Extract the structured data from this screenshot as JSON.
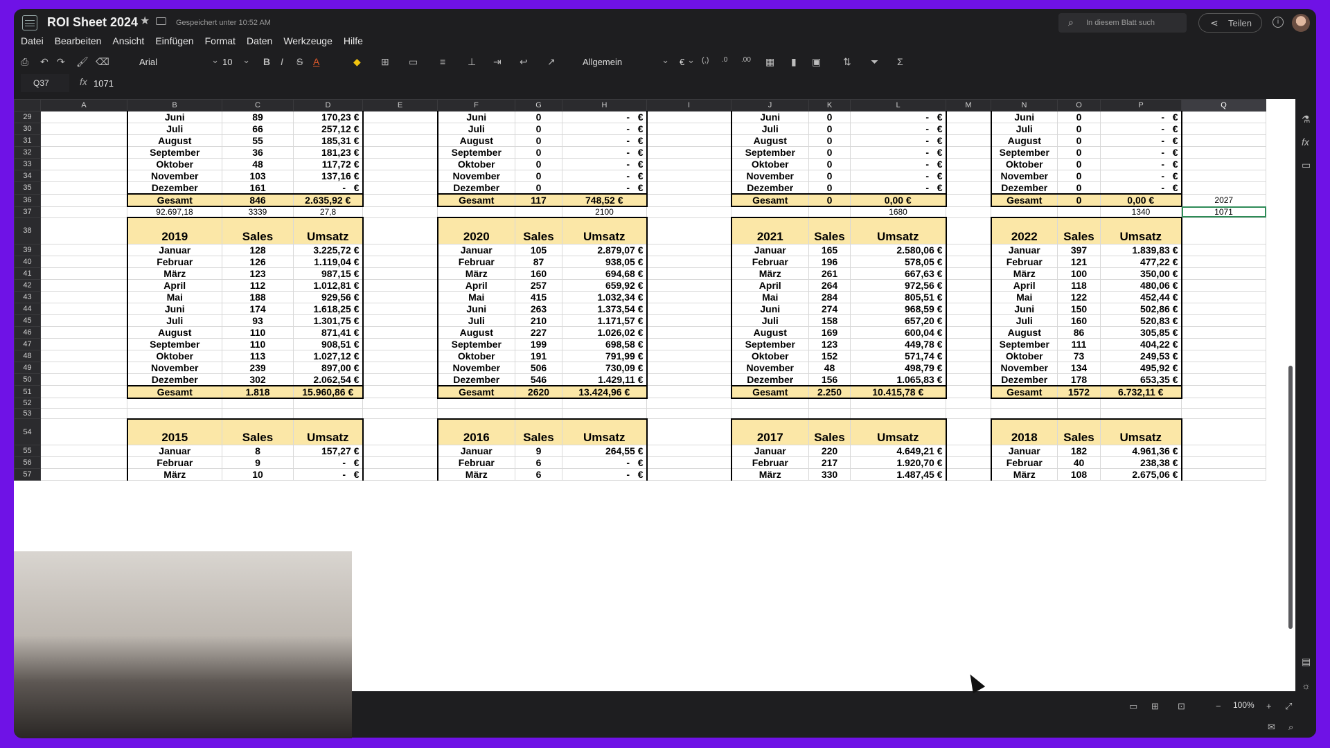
{
  "app": {
    "title": "ROI Sheet 2024",
    "saved_status": "Gespeichert unter 10:52 AM",
    "search_placeholder": "In diesem Blatt such",
    "share_label": "Teilen"
  },
  "menu": [
    "Datei",
    "Bearbeiten",
    "Ansicht",
    "Einfügen",
    "Format",
    "Daten",
    "Werkzeuge",
    "Hilfe"
  ],
  "toolbar": {
    "font": "Arial",
    "font_size": "10",
    "number_format": "Allgemein",
    "currency": "€",
    "icons": [
      "print-icon",
      "undo-icon",
      "redo-icon",
      "paint-format-icon",
      "clear-format-icon",
      "bold-icon",
      "italic-icon",
      "strikethrough-icon",
      "text-color-icon",
      "fill-color-icon",
      "borders-icon",
      "merge-icon",
      "align-horizontal-icon",
      "align-vertical-icon",
      "indent-icon",
      "wrap-icon",
      "rotate-icon",
      "parentheses-icon",
      "decimal-decrease-icon",
      "decimal-increase-icon",
      "insert-table-icon",
      "chart-icon",
      "image-icon",
      "sort-icon",
      "filter-icon",
      "sum-icon"
    ]
  },
  "formula_bar": {
    "cell_ref": "Q37",
    "fx": "fx",
    "value": "1071"
  },
  "columns": [
    "",
    "A",
    "B",
    "C",
    "D",
    "E",
    "F",
    "G",
    "H",
    "I",
    "J",
    "K",
    "L",
    "M",
    "N",
    "O",
    "P",
    "Q"
  ],
  "months": [
    "Januar",
    "Februar",
    "März",
    "April",
    "Mai",
    "Juni",
    "Juli",
    "August",
    "September",
    "Oktober",
    "November",
    "Dezember"
  ],
  "labels": {
    "sales": "Sales",
    "umsatz": "Umsatz",
    "gesamt": "Gesamt",
    "dash": "-",
    "euro": "€"
  },
  "top_rows": {
    "row_numbers": [
      "29",
      "30",
      "31",
      "32",
      "33",
      "34",
      "35"
    ],
    "months": [
      "Juni",
      "Juli",
      "August",
      "September",
      "Oktober",
      "November",
      "Dezember"
    ],
    "b_sales": [
      "89",
      "66",
      "55",
      "36",
      "48",
      "103",
      "161"
    ],
    "b_umsatz": [
      "170,23 €",
      "257,12 €",
      "185,31 €",
      "181,23 €",
      "117,72 €",
      "137,16 €",
      "-"
    ],
    "zero": "0",
    "row36": {
      "num": "36",
      "b_sales": "846",
      "b_umsatz": "2.635,92 €",
      "f_sales": "117",
      "f_umsatz": "748,52 €",
      "j_sales": "0",
      "j_umsatz": "0,00 €",
      "n_sales": "0",
      "n_umsatz": "0,00 €",
      "q": "2027"
    },
    "row37": {
      "num": "37",
      "b": "92.697,18",
      "c": "3339",
      "d": "27,8",
      "h": "2100",
      "l": "1680",
      "p": "1340",
      "q": "1071"
    }
  },
  "block_rows_1": [
    "38",
    "39",
    "40",
    "41",
    "42",
    "43",
    "44",
    "45",
    "46",
    "47",
    "48",
    "49",
    "50",
    "51"
  ],
  "block_rows_2": [
    "54",
    "55",
    "56",
    "57"
  ],
  "gap_rows": [
    "52",
    "53"
  ],
  "tables_row1": [
    {
      "year": "2019",
      "sales": [
        "128",
        "126",
        "123",
        "112",
        "188",
        "174",
        "93",
        "110",
        "110",
        "113",
        "239",
        "302"
      ],
      "umsatz": [
        "3.225,72 €",
        "1.119,04 €",
        "987,15 €",
        "1.012,81 €",
        "929,56 €",
        "1.618,25 €",
        "1.301,75 €",
        "871,41 €",
        "908,51 €",
        "1.027,12 €",
        "897,00 €",
        "2.062,54 €"
      ],
      "total_sales": "1.818",
      "total_umsatz": "15.960,86 €"
    },
    {
      "year": "2020",
      "sales": [
        "105",
        "87",
        "160",
        "257",
        "415",
        "263",
        "210",
        "227",
        "199",
        "191",
        "506",
        "546"
      ],
      "umsatz": [
        "2.879,07 €",
        "938,05 €",
        "694,68 €",
        "659,92 €",
        "1.032,34 €",
        "1.373,54 €",
        "1.171,57 €",
        "1.026,02 €",
        "698,58 €",
        "791,99 €",
        "730,09 €",
        "1.429,11 €"
      ],
      "total_sales": "2620",
      "total_umsatz": "13.424,96 €"
    },
    {
      "year": "2021",
      "sales": [
        "165",
        "196",
        "261",
        "264",
        "284",
        "274",
        "158",
        "169",
        "123",
        "152",
        "48",
        "156"
      ],
      "umsatz": [
        "2.580,06 €",
        "578,05 €",
        "667,63 €",
        "972,56 €",
        "805,51 €",
        "968,59 €",
        "657,20 €",
        "600,04 €",
        "449,78 €",
        "571,74 €",
        "498,79 €",
        "1.065,83 €"
      ],
      "total_sales": "2.250",
      "total_umsatz": "10.415,78 €"
    },
    {
      "year": "2022",
      "sales": [
        "397",
        "121",
        "100",
        "118",
        "122",
        "150",
        "160",
        "86",
        "111",
        "73",
        "134",
        "178"
      ],
      "umsatz": [
        "1.839,83 €",
        "477,22 €",
        "350,00 €",
        "480,06 €",
        "452,44 €",
        "502,86 €",
        "520,83 €",
        "305,85 €",
        "404,22 €",
        "249,53 €",
        "495,92 €",
        "653,35 €"
      ],
      "total_sales": "1572",
      "total_umsatz": "6.732,11 €"
    }
  ],
  "tables_row2": [
    {
      "year": "2015",
      "sales": [
        "8",
        "9",
        "10"
      ],
      "umsatz": [
        "157,27 €",
        "-",
        "-"
      ]
    },
    {
      "year": "2016",
      "sales": [
        "9",
        "6",
        "6"
      ],
      "umsatz": [
        "264,55 €",
        "-",
        "-"
      ]
    },
    {
      "year": "2017",
      "sales": [
        "220",
        "217",
        "330"
      ],
      "umsatz": [
        "4.649,21 €",
        "1.920,70 €",
        "1.487,45 €"
      ]
    },
    {
      "year": "2018",
      "sales": [
        "182",
        "40",
        "108"
      ],
      "umsatz": [
        "4.961,36 €",
        "238,38 €",
        "2.675,06 €"
      ]
    }
  ],
  "status": {
    "zoom": "100%"
  }
}
